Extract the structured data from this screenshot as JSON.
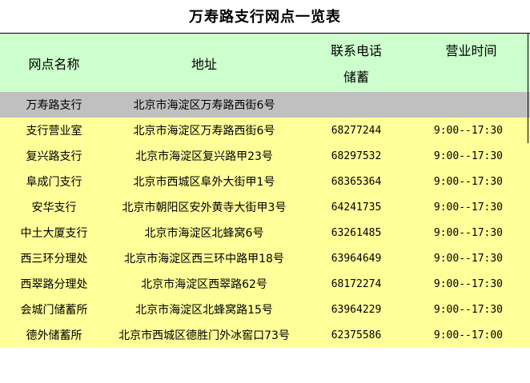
{
  "title": "万寿路支行网点一览表",
  "headers": {
    "name": "网点名称",
    "address": "地址",
    "phone_line1": "联系电话",
    "phone_line2": "储蓄",
    "hours": "营业时间"
  },
  "highlight": {
    "name": "万寿路支行",
    "address": "北京市海淀区万寿路西街6号"
  },
  "rows": [
    {
      "name": "支行营业室",
      "address": "北京市海淀区万寿路西街6号",
      "phone": "68277244",
      "hours": "9:00--17:30"
    },
    {
      "name": "复兴路支行",
      "address": "北京市海淀区复兴路甲23号",
      "phone": "68297532",
      "hours": "9:00--17:30"
    },
    {
      "name": "阜成门支行",
      "address": "北京市西城区阜外大街甲1号",
      "phone": "68365364",
      "hours": "9:00--17:30"
    },
    {
      "name": "安华支行",
      "address": "北京市朝阳区安外黄寺大街甲3号",
      "phone": "64241735",
      "hours": "9:00--17:30"
    },
    {
      "name": "中土大厦支行",
      "address": "北京市海淀区北蜂窝6号",
      "phone": "63261485",
      "hours": "9:00--17:30"
    },
    {
      "name": "西三环分理处",
      "address": "北京市海淀区西三环中路甲18号",
      "phone": "63964649",
      "hours": "9:00--17:30"
    },
    {
      "name": "西翠路分理处",
      "address": "北京市海淀区西翠路62号",
      "phone": "68172274",
      "hours": "9:00--17:30"
    },
    {
      "name": "会城门储蓄所",
      "address": "北京市海淀区北蜂窝路15号",
      "phone": "63964229",
      "hours": "9:00--17:30"
    },
    {
      "name": "德外储蓄所",
      "address": "北京市西城区德胜门外冰窖口73号",
      "phone": "62375586",
      "hours": "9:00--17:00"
    }
  ]
}
